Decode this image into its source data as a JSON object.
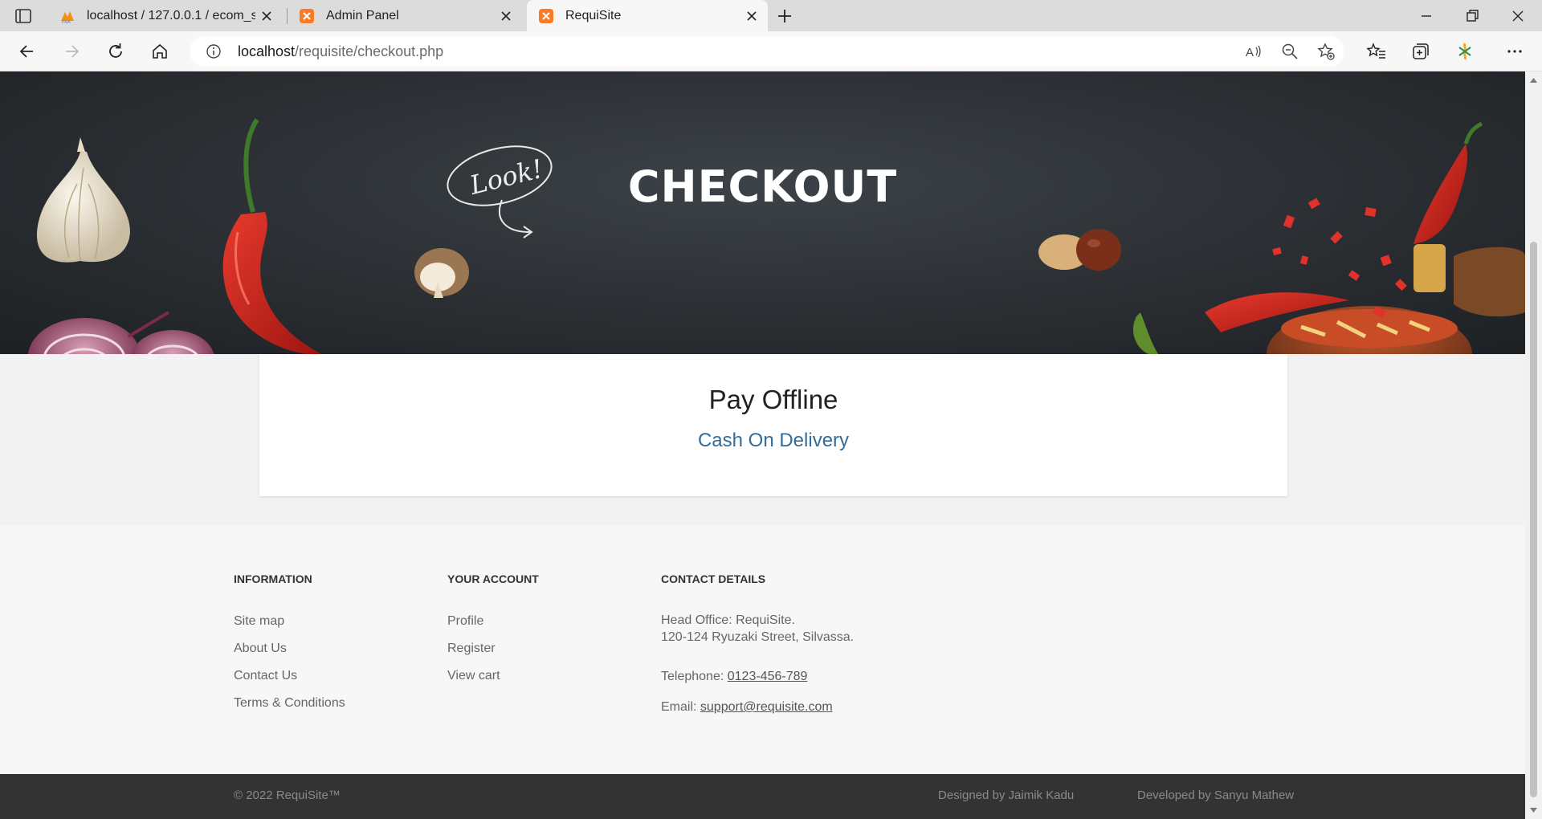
{
  "browser": {
    "tabs": [
      {
        "title": "localhost / 127.0.0.1 / ecom_store | p",
        "favicon": "phpmyadmin-icon"
      },
      {
        "title": "Admin Panel",
        "favicon": "xampp-icon"
      },
      {
        "title": "RequiSite",
        "favicon": "xampp-icon",
        "active": true
      }
    ],
    "url_host": "localhost",
    "url_path": "/requisite/checkout.php"
  },
  "hero": {
    "title": "CHECKOUT",
    "chalk_note": "Look!"
  },
  "payment": {
    "heading": "Pay Offline",
    "option_label": "Cash On Delivery"
  },
  "footer": {
    "information": {
      "heading": "INFORMATION",
      "links": [
        "Site map",
        "About Us",
        "Contact Us",
        "Terms & Conditions"
      ]
    },
    "account": {
      "heading": "YOUR ACCOUNT",
      "links": [
        "Profile",
        "Register",
        "View cart"
      ]
    },
    "contact": {
      "heading": "CONTACT DETAILS",
      "office_line1": "Head Office: RequiSite.",
      "office_line2": "120-124 Ryuzaki Street, Silvassa.",
      "telephone_label": "Telephone:",
      "telephone": "0123-456-789",
      "email_label": "Email:",
      "email": "support@requisite.com"
    },
    "copyright": "© 2022 RequiSite™",
    "designed_by": "Designed by Jaimik Kadu",
    "developed_by": "Developed by Sanyu Mathew"
  },
  "colors": {
    "link_blue": "#336b99",
    "footer_dark": "#333333",
    "hero_bg": "#2b2f33"
  }
}
